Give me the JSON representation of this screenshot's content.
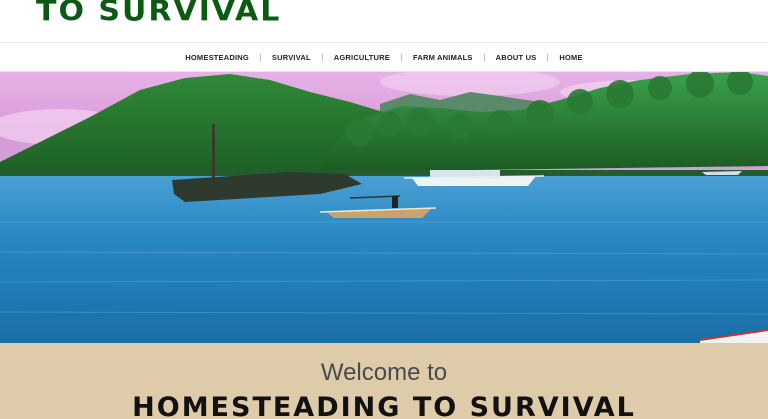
{
  "header": {
    "logo_text": "TO SURVIVAL"
  },
  "nav": {
    "items": [
      {
        "label": "HOMESTEADING"
      },
      {
        "label": "SURVIVAL"
      },
      {
        "label": "AGRICULTURE"
      },
      {
        "label": "FARM ANIMALS"
      },
      {
        "label": "ABOUT US"
      },
      {
        "label": "HOME"
      }
    ]
  },
  "welcome": {
    "intro": "Welcome to",
    "title": "HOMESTEADING TO SURVIVAL"
  },
  "colors": {
    "logo_green": "#0b5a14",
    "banner_tan": "#ddcbaa",
    "water_blue": "#1f7fb5"
  }
}
